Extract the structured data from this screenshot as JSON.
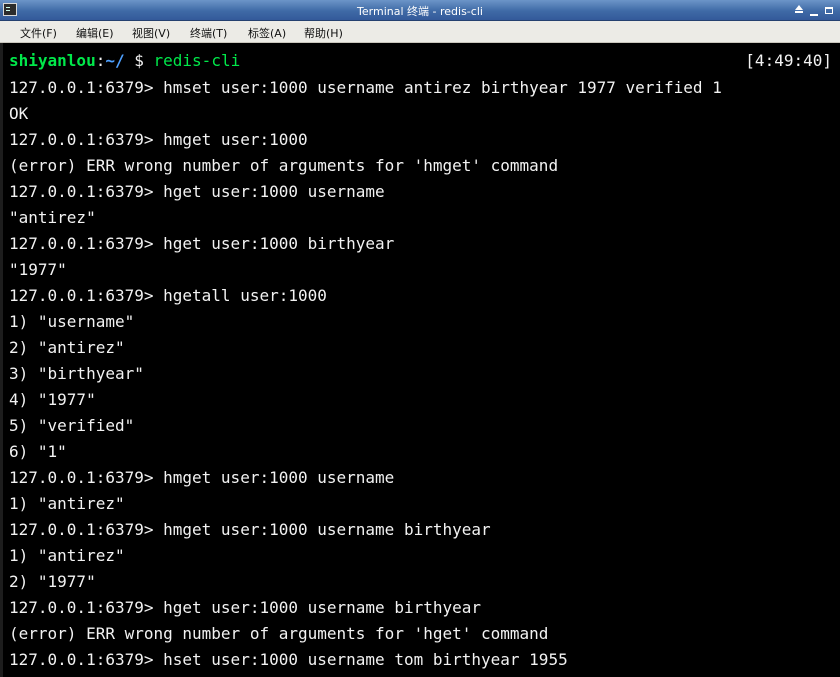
{
  "window": {
    "title": "Terminal 终端 - redis-cli"
  },
  "menu": {
    "items": [
      "文件(F)",
      "编辑(E)",
      "视图(V)",
      "终端(T)",
      "标签(A)",
      "帮助(H)"
    ]
  },
  "prompt": {
    "user": "shiyanlou",
    "colon": ":",
    "path": "~/",
    "dollar": " $ ",
    "command": "redis-cli",
    "clock": "[4:49:40]"
  },
  "terminal": {
    "lines": [
      "127.0.0.1:6379> hmset user:1000 username antirez birthyear 1977 verified 1",
      "OK",
      "127.0.0.1:6379> hmget user:1000",
      "(error) ERR wrong number of arguments for 'hmget' command",
      "127.0.0.1:6379> hget user:1000 username",
      "\"antirez\"",
      "127.0.0.1:6379> hget user:1000 birthyear",
      "\"1977\"",
      "127.0.0.1:6379> hgetall user:1000",
      "1) \"username\"",
      "2) \"antirez\"",
      "3) \"birthyear\"",
      "4) \"1977\"",
      "5) \"verified\"",
      "6) \"1\"",
      "127.0.0.1:6379> hmget user:1000 username",
      "1) \"antirez\"",
      "127.0.0.1:6379> hmget user:1000 username birthyear",
      "1) \"antirez\"",
      "2) \"1977\"",
      "127.0.0.1:6379> hget user:1000 username birthyear",
      "(error) ERR wrong number of arguments for 'hget' command",
      "127.0.0.1:6379> hset user:1000 username tom birthyear 1955"
    ]
  },
  "colors": {
    "background": "#000000",
    "text": "#f2f2f2",
    "prompt_user": "#00e84a",
    "prompt_path": "#4ea0ff",
    "titlebar": "#3f6aa6",
    "menubar": "#ecebe6"
  }
}
